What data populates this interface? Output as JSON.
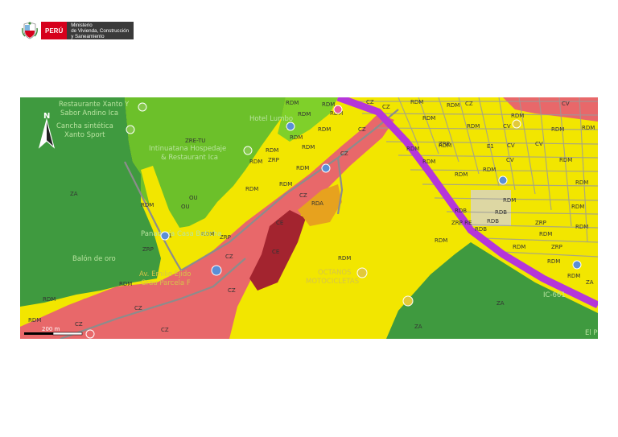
{
  "header": {
    "country": "PERÚ",
    "ministry_lines": [
      "Ministerio",
      "de Vivienda, Construcción",
      "y Saneamiento"
    ]
  },
  "map": {
    "north_label": "N",
    "scale_label": "200 m",
    "colors": {
      "ZA": "#3f9a3f",
      "ZRE-TU": "#6cc02a",
      "RDM": "#f2e600",
      "CZ": "#e8686a",
      "CE": "#a3242f",
      "RDA": "#e7a21e",
      "ZRP": "#bcd840",
      "OU": "#b0b0b0",
      "E1": "#5a8fd6",
      "highway": "#b536d9"
    },
    "places": {
      "p1": "Restaurante Xanto Y",
      "p2": "Sabor Andino Ica",
      "p3": "Cancha sintética",
      "p4": "Xanto Sport",
      "p5": "Hotel Lumbo",
      "p6": "Intinuatana Hospedaje",
      "p7": "& Restaurant Ica",
      "p8": "Panadería Casa Baticha",
      "p9": "Balón de oro",
      "p10": "Av. Emilio Ejido",
      "p11": "Grau Parcela F",
      "p12": "OCTANOS",
      "p13": "MOTOCICLETAS",
      "p14": "IC-661",
      "p15": "El P"
    },
    "labels": {
      "za1": "ZA",
      "za2": "ZA",
      "za3": "ZA",
      "za4": "ZA",
      "zre": "ZRE-TU",
      "rdm1": "RDM",
      "rdm2": "RDM",
      "rdm3": "RDM",
      "rdm4": "RDM",
      "rdm5": "RDM",
      "rdm6": "RDM",
      "rdm7": "RDM",
      "rdm8": "RDM",
      "rdm9": "RDM",
      "rdm10": "RDM",
      "rdm11": "RDM",
      "rdm12": "RDM",
      "rdm13": "RDM",
      "rdm14": "RDM",
      "rdm15": "RDM",
      "rdm16": "RDM",
      "rdm17": "RDM",
      "rdm18": "RDM",
      "rdm19": "RDM",
      "rdm20": "RDM",
      "rdm21": "RDM",
      "rdm22": "RDM",
      "rdm23": "RDM",
      "rdm24": "RDM",
      "rdm25": "RDM",
      "rdm26": "RDM",
      "rdm27": "RDM",
      "rdm28": "RDM",
      "rdm29": "RDM",
      "rdm30": "RDM",
      "rdm31": "RDM",
      "rdm32": "RDM",
      "rdm33": "RDM",
      "rdm34": "RDM",
      "rdm35": "RDM",
      "rdm36": "RDM",
      "rdm37": "RDM",
      "rdm38": "RDM",
      "rdm39": "RDM",
      "rdm40": "RDM",
      "cz1": "CZ",
      "cz2": "CZ",
      "cz3": "CZ",
      "cz4": "CZ",
      "cz5": "CZ",
      "cz6": "CZ",
      "cz7": "CZ",
      "cz8": "CZ",
      "cz9": "CZ",
      "cz10": "CZ",
      "cz11": "CZ",
      "ce1": "CE",
      "ce2": "CE",
      "rda": "RDA",
      "zrp1": "ZRP",
      "zrp2": "ZRP",
      "zrp3": "ZRP",
      "zrp4": "ZRP",
      "zrp5": "ZRP",
      "zrp6": "ZRP",
      "ou1": "OU",
      "ou2": "OU",
      "e1a": "E1",
      "e1b": "E1",
      "e1c": "E1",
      "cv1": "CV",
      "cv2": "CV",
      "cv3": "CV",
      "cv4": "CV",
      "cv5": "CV",
      "rdb1": "RDB",
      "rdb2": "RDB",
      "rdb3": "RDB",
      "rdb4": "RDB",
      "zrpre": "ZRP RE"
    }
  }
}
